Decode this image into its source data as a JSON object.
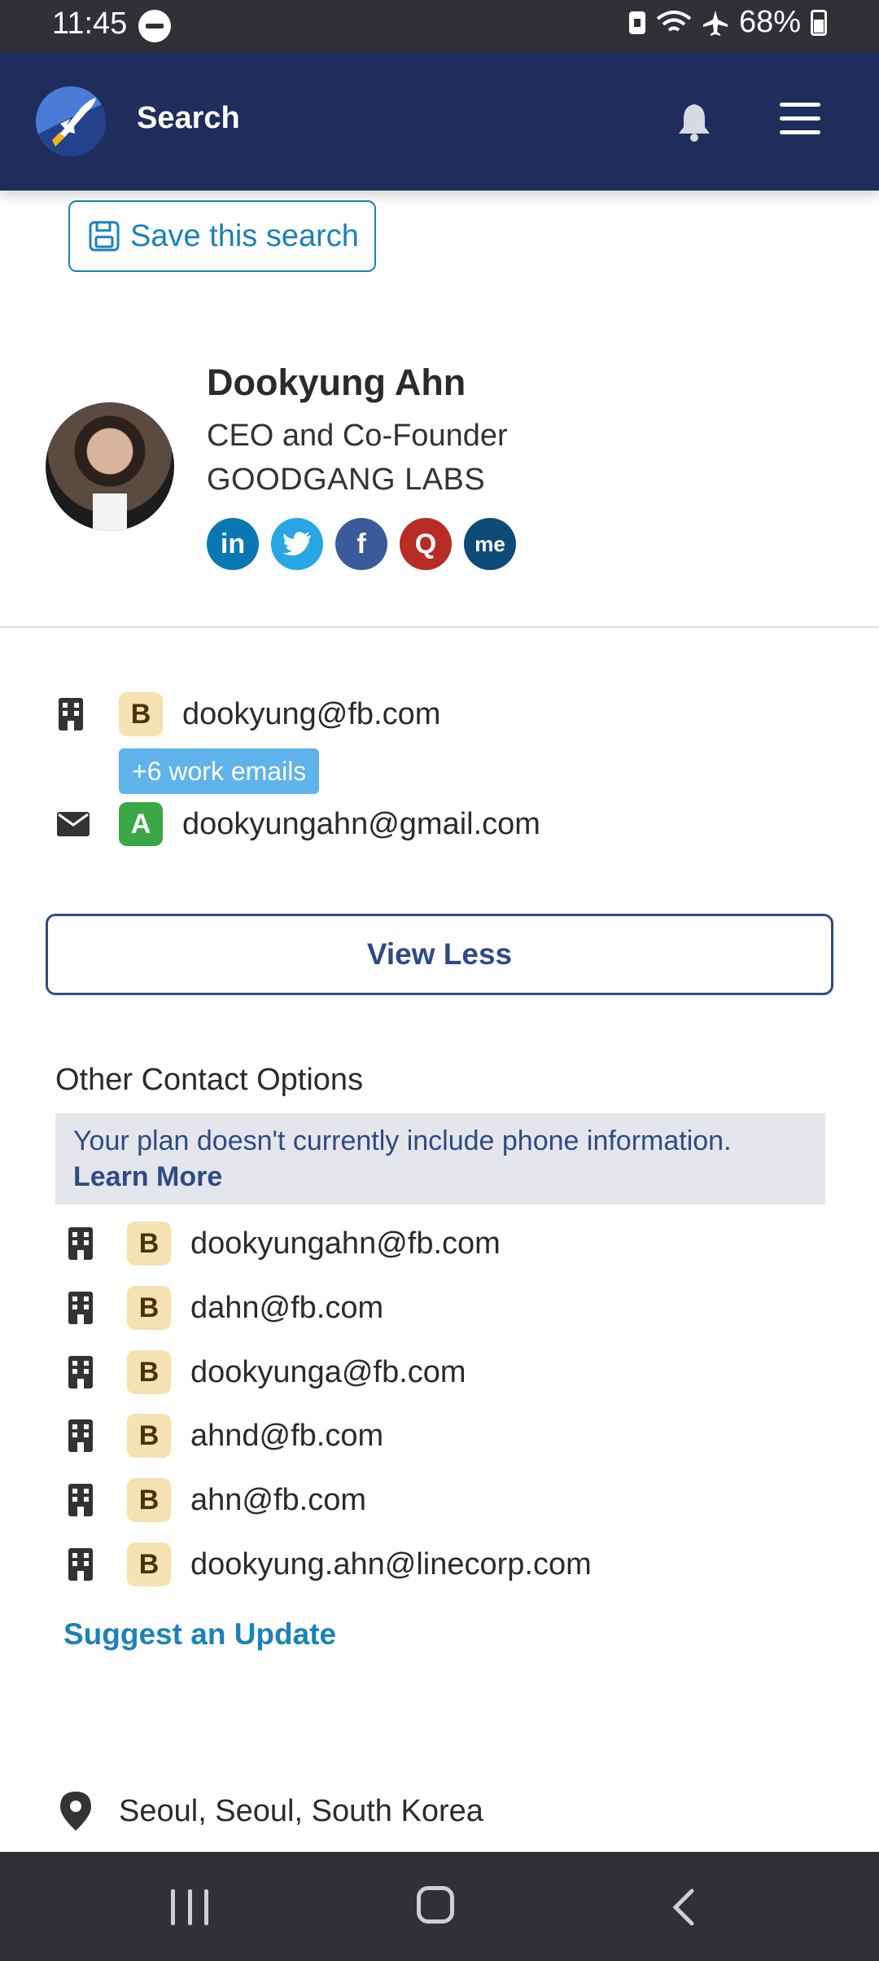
{
  "status_bar": {
    "time": "11:45",
    "battery": "68%"
  },
  "app_bar": {
    "title": "Search"
  },
  "save_search": {
    "label": "Save this search"
  },
  "profile": {
    "name": "Dookyung Ahn",
    "title": "CEO and Co-Founder",
    "company": "GOODGANG LABS",
    "socials": [
      {
        "name": "linkedin",
        "glyph": "in",
        "color": "#0a77b5"
      },
      {
        "name": "twitter",
        "glyph": "🐦",
        "color": "#28a6e3"
      },
      {
        "name": "facebook",
        "glyph": "f",
        "color": "#3b5a9a"
      },
      {
        "name": "quora",
        "glyph": "Q",
        "color": "#b92b27"
      },
      {
        "name": "aboutme",
        "glyph": "me",
        "color": "#0d4a78"
      }
    ]
  },
  "emails": {
    "primary_work": {
      "grade": "B",
      "email": "dookyung@fb.com"
    },
    "more_work_label": "+6 work emails",
    "personal": {
      "grade": "A",
      "email": "dookyungahn@gmail.com"
    }
  },
  "view_less_label": "View Less",
  "other_contacts": {
    "heading": "Other Contact Options",
    "plan_note": "Your plan doesn't currently include phone information.",
    "learn_more": "Learn More",
    "items": [
      {
        "grade": "B",
        "email": "dookyungahn@fb.com"
      },
      {
        "grade": "B",
        "email": "dahn@fb.com"
      },
      {
        "grade": "B",
        "email": "dookyunga@fb.com"
      },
      {
        "grade": "B",
        "email": "ahnd@fb.com"
      },
      {
        "grade": "B",
        "email": "ahn@fb.com"
      },
      {
        "grade": "B",
        "email": "dookyung.ahn@linecorp.com"
      }
    ]
  },
  "suggest_update_label": "Suggest an Update",
  "location": "Seoul, Seoul, South Korea"
}
